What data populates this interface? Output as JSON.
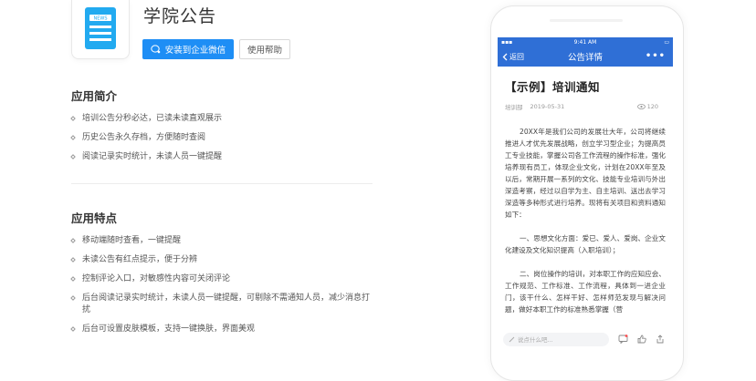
{
  "app": {
    "title": "学院公告",
    "icon": "news-document-icon",
    "install_button": "安装到企业微信",
    "help_button": "使用帮助"
  },
  "intro": {
    "heading": "应用简介",
    "items": [
      "培训公告分秒必达，已读未读直观展示",
      "历史公告永久存档，方便随时查阅",
      "阅读记录实时统计，未读人员一键提醒"
    ]
  },
  "features": {
    "heading": "应用特点",
    "items": [
      "移动端随时查看，一键提醒",
      "未读公告有红点提示，便于分辨",
      "控制评论入口，对敏感性内容可关闭评论",
      "后台阅读记录实时统计，未读人员一键提醒，可剔除不需通知人员，减少消息打扰",
      "后台可设置皮肤模板，支持一键换肤，界面美观"
    ]
  },
  "phone": {
    "status_time": "9:41 AM",
    "back_label": "返回",
    "nav_title": "公告详情",
    "more_label": "•••",
    "article": {
      "title": "【示例】培训通知",
      "dept": "培训部",
      "date": "2019-05-31",
      "views": "120",
      "paragraphs": [
        "20XX年是我们公司的发展壮大年，公司将继续推进人才优先发展战略，创立学习型企业；为提高员工专业技能，掌握公司各工作流程的操作标准，强化培养现有员工，体现企业文化，计划在20XX年至及以后，常期开展一系列的文化、技能专业培训与外出深造考察，经过以自学为主、自主培训、送出去学习深造等多种形式进行培养。现将有关项目和资料通知如下：",
        "一、思想文化方面：爱已、爱人、爱岗、企业文化建设及文化知识提高（入职培训）；",
        "二、岗位操作的培训，对本职工作的应知应会、工作规范、工作标准、工作流程，具体到一进企业门，该干什么、怎样干好、怎样师范发现与解决问题，做好本职工作的标准熟悉掌握（营"
      ]
    },
    "comment_placeholder": "说点什么吧..."
  },
  "colors": {
    "accent": "#1e8ef5",
    "phone_header": "#2f6fd6"
  }
}
